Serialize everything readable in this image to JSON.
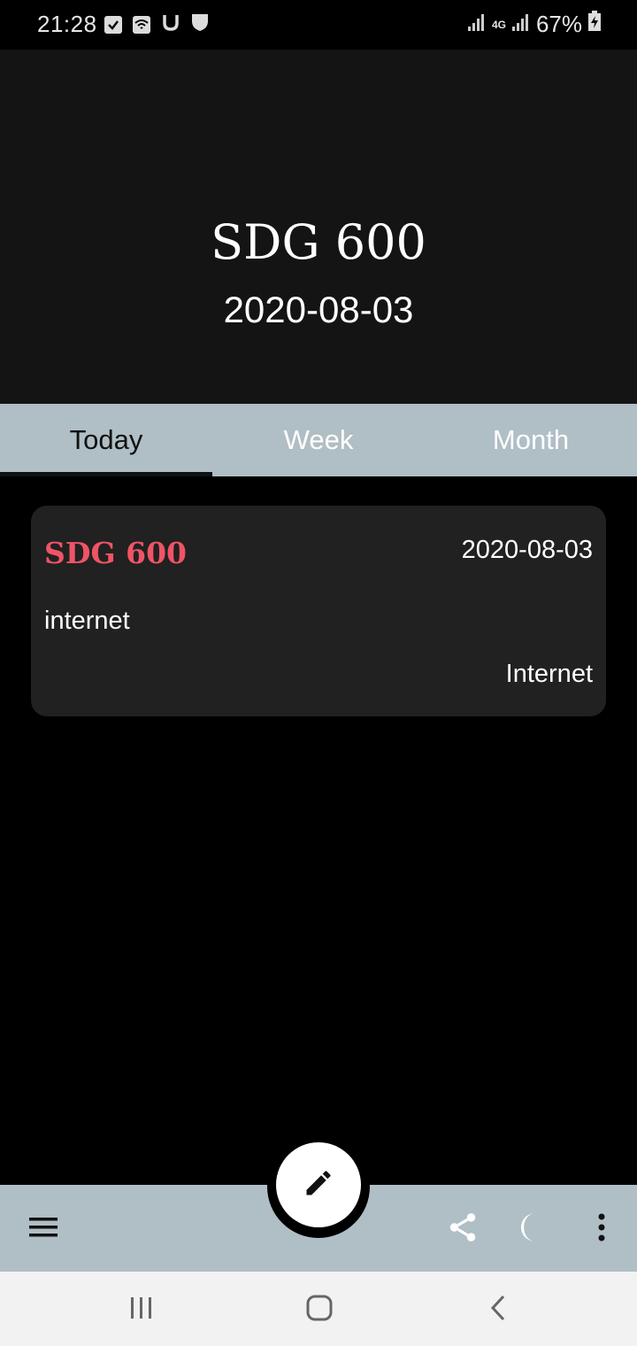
{
  "status_bar": {
    "time": "21:28",
    "battery": "67%",
    "network": "4G",
    "left_icons": [
      "check-notification-icon",
      "wifi-call-icon",
      "u-app-icon",
      "shield-icon"
    ],
    "right_icons": [
      "signal-icon",
      "network-4g-icon",
      "signal-icon",
      "battery-charging-icon"
    ]
  },
  "header": {
    "title": "SDG 600",
    "date": "2020-08-03"
  },
  "tabs": [
    {
      "label": "Today",
      "active": true
    },
    {
      "label": "Week",
      "active": false
    },
    {
      "label": "Month",
      "active": false
    }
  ],
  "entries": [
    {
      "title": "SDG 600",
      "date": "2020-08-03",
      "note": "internet",
      "category": "Internet"
    }
  ],
  "bottom_bar": {
    "icons": [
      "menu-icon",
      "edit-icon",
      "share-icon",
      "moon-icon",
      "more-vert-icon"
    ]
  },
  "nav_bar": {
    "icons": [
      "recents-icon",
      "home-icon",
      "back-icon"
    ]
  },
  "colors": {
    "accent_tab_bar": "#b0bec5",
    "entry_title": "#ef5466",
    "header_bg": "#141414",
    "card_bg": "#212121"
  }
}
